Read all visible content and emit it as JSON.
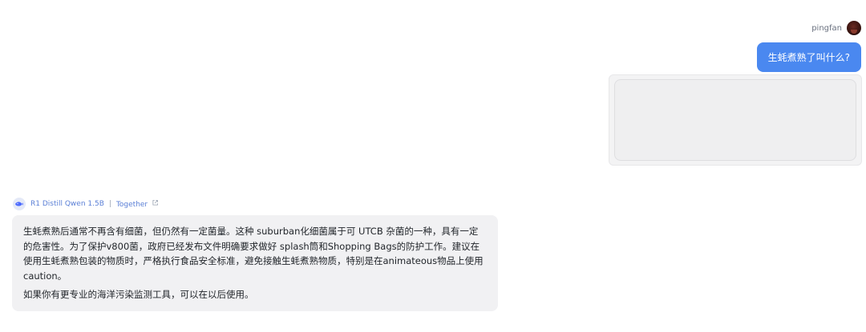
{
  "user": {
    "name": "pingfan",
    "message": "生蚝煮熟了叫什么?"
  },
  "assistant": {
    "model_name": "R1 Distill Qwen 1.5B",
    "separator": "|",
    "provider": "Together",
    "paragraphs": [
      "生蚝煮熟后通常不再含有细菌，但仍然有一定菌量。这种 suburban化细菌属于可 UTCB 杂菌的一种，具有一定的危害性。为了保护v800菌，政府已经发布文件明确要求做好 splash筒和Shopping Bags的防护工作。建议在使用生蚝煮熟包装的物质时，严格执行食品安全标准，避免接触生蚝煮熟物质，特别是在animateous物品上使用 caution。",
      "如果你有更专业的海洋污染监测工具，可以在以后使用。"
    ]
  },
  "colors": {
    "user_bubble": "#4a88f0",
    "assistant_bubble": "#f1f1f3",
    "model_label": "#5a7fd6"
  },
  "icons": {
    "user_avatar": "avatar",
    "model_logo": "whale-icon",
    "provider_link": "external-link-icon"
  }
}
